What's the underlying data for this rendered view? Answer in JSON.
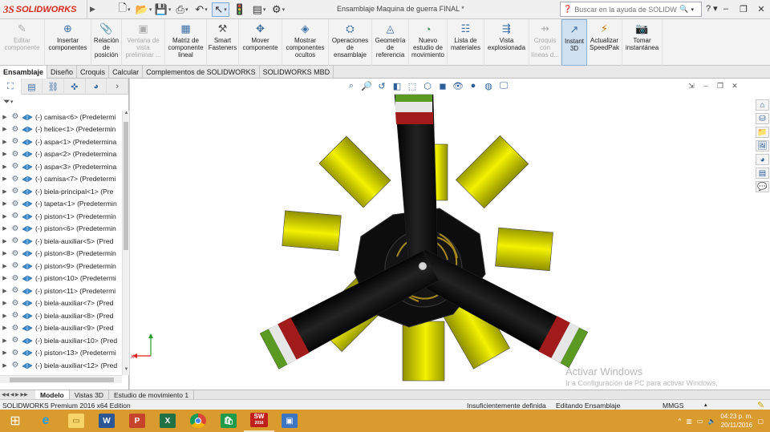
{
  "app": {
    "brand_ds": "3S",
    "brand_name": "SOLIDWORKS",
    "document_title": "Ensamblaje Maquina de guerra FINAL *",
    "search_placeholder": "Buscar en la ayuda de SOLIDWORKS"
  },
  "ribbon": [
    {
      "label": "Editar\ncomponente",
      "icon": "edit-component-icon",
      "disabled": true
    },
    {
      "label": "Insertar\ncomponentes",
      "icon": "insert-components-icon",
      "disabled": false
    },
    {
      "label": "Relación\nde\nposición",
      "icon": "mate-icon",
      "disabled": false
    },
    {
      "label": "Ventana de\nvista\npreliminar ...",
      "icon": "preview-window-icon",
      "disabled": true
    },
    {
      "label": "Matriz de\ncomponente\nlineal",
      "icon": "linear-pattern-icon",
      "disabled": false
    },
    {
      "label": "Smart\nFasteners",
      "icon": "smart-fasteners-icon",
      "disabled": false
    },
    {
      "label": "Mover\ncomponente",
      "icon": "move-component-icon",
      "disabled": false
    },
    {
      "label": "Mostrar\ncomponentes\nocultos",
      "icon": "show-hidden-icon",
      "disabled": false
    },
    {
      "label": "Operaciones\nde\nensamblaje",
      "icon": "assembly-features-icon",
      "disabled": false
    },
    {
      "label": "Geometría\nde\nreferencia",
      "icon": "reference-geometry-icon",
      "disabled": false
    },
    {
      "label": "Nuevo\nestudio de\nmovimiento",
      "icon": "motion-study-icon",
      "disabled": false
    },
    {
      "label": "Lista de\nmateriales",
      "icon": "bom-icon",
      "disabled": false
    },
    {
      "label": "Vista\nexplosionada",
      "icon": "exploded-view-icon",
      "disabled": false
    },
    {
      "label": "Croquis\ncon\nlíneas d...",
      "icon": "explode-sketch-icon",
      "disabled": true
    },
    {
      "label": "Instant\n3D",
      "icon": "instant3d-icon",
      "disabled": false,
      "active": true
    },
    {
      "label": "Actualizar\nSpeedPak",
      "icon": "speedpak-icon",
      "disabled": false
    },
    {
      "label": "Tomar\ninstantánea",
      "icon": "snapshot-icon",
      "disabled": false
    }
  ],
  "command_tabs": [
    "Ensamblaje",
    "Diseño",
    "Croquis",
    "Calcular",
    "Complementos de SOLIDWORKS",
    "SOLIDWORKS MBD"
  ],
  "active_command_tab": "Ensamblaje",
  "tree_items": [
    "(-) camisa<6> (Predetermi",
    "(-) helice<1> (Predetermin",
    "(-) aspa<1> (Predetermina",
    "(-) aspa<2> (Predetermina",
    "(-) aspa<3> (Predetermina",
    "(-) camisa<7> (Predetermi",
    "(-) biela-principal<1> (Pre",
    "(-) tapeta<1> (Predetermin",
    "(-) piston<1> (Predetermin",
    "(-) piston<6> (Predetermin",
    "(-) biela-auxiliar<5> (Pred",
    "(-) piston<8> (Predetermin",
    "(-) piston<9> (Predetermin",
    "(-) piston<10> (Predetermi",
    "(-) piston<11> (Predetermi",
    "(-) biela-auxiliar<7> (Pred",
    "(-) biela-auxiliar<8> (Pred",
    "(-) biela-auxiliar<9> (Pred",
    "(-) biela-auxiliar<10> (Pred",
    "(-) piston<13> (Predetermi",
    "(-) biela-auxiliar<12> (Pred"
  ],
  "bottom_tabs": [
    "Modelo",
    "Vistas 3D",
    "Estudio de movimiento 1"
  ],
  "active_bottom_tab": "Modelo",
  "watermark": {
    "title": "Activar Windows",
    "subtitle": "Ir a Configuración de PC para activar Windows."
  },
  "status": {
    "edition": "SOLIDWORKS Premium 2016 x64 Edition",
    "definition": "Insuficientemente definida",
    "mode": "Editando Ensamblaje",
    "units": "MMGS"
  },
  "taskbar": {
    "time": "04:23 p. m.",
    "date": "20/11/2016",
    "apps": [
      "start-button",
      "ie-icon",
      "explorer-icon",
      "word-icon",
      "powerpoint-icon",
      "excel-icon",
      "chrome-icon",
      "store-icon",
      "solidworks-icon",
      "photos-icon"
    ],
    "sw_year": "2016"
  },
  "colors": {
    "accent": "#d99a2e",
    "blade_black": "#111111",
    "cylinder_yellow": "#e6e600",
    "stripe_green": "#55a11f",
    "stripe_red": "#b31b1b",
    "stripe_white": "#e8e8e8",
    "brand_red": "#d52b1e"
  },
  "triad": {
    "x": "X",
    "y": "Y"
  }
}
